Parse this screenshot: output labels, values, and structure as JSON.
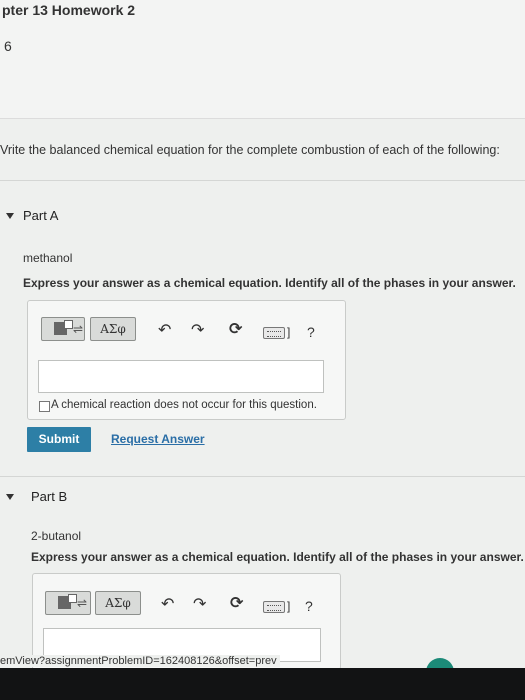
{
  "header": {
    "chapter_title": "pter 13 Homework 2",
    "problem_number": "6"
  },
  "instructions": "Vrite the balanced chemical equation for the complete combustion of each of the following:",
  "parts": [
    {
      "title": "Part A",
      "compound": "methanol",
      "prompt": "Express your answer as a chemical equation. Identify all of the phases in your answer.",
      "no_reaction_label": "A chemical reaction does not occur for this question.",
      "submit_label": "Submit",
      "request_label": "Request Answer"
    },
    {
      "title": "Part B",
      "compound": "2-butanol",
      "prompt": "Express your answer as a chemical equation. Identify all of the phases in your answer. If"
    }
  ],
  "toolbar": {
    "greek_label": "ΑΣφ",
    "undo_icon": "undo-icon",
    "redo_icon": "redo-icon",
    "reset_icon": "reset-icon",
    "keyboard_icon": "keyboard-icon",
    "help_label": "?",
    "bracket_label": "]"
  },
  "status_bar": {
    "url": "emView?assignmentProblemID=162408126&offset=prev"
  },
  "colors": {
    "submit": "#2d7fa6",
    "link": "#2a6ea6",
    "bottom_bar": "#121314"
  }
}
